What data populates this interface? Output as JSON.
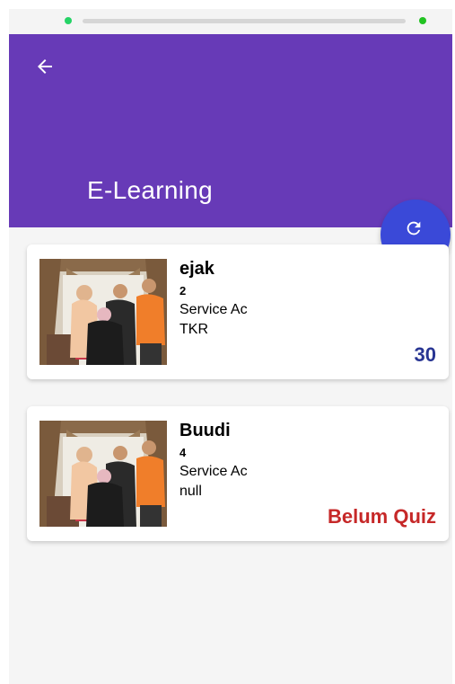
{
  "app": {
    "title": "E-Learning",
    "primary_color": "#673ab7",
    "fab_color": "#3a49d8",
    "back_icon": "arrow-left-icon",
    "fab_icon": "refresh-icon"
  },
  "status_bar": {
    "icons": [
      "whatsapp-icon",
      "battery-icon"
    ]
  },
  "cards": [
    {
      "name": "ejak",
      "number": "2",
      "subject": "Service Ac",
      "detail": "TKR",
      "score": "30",
      "score_color": "#283593",
      "photo_icon": "family-photo"
    },
    {
      "name": "Buudi",
      "number": "4",
      "subject": "Service Ac",
      "detail": "null",
      "score": "Belum Quiz",
      "score_color": "#c62828",
      "photo_icon": "family-photo"
    }
  ]
}
